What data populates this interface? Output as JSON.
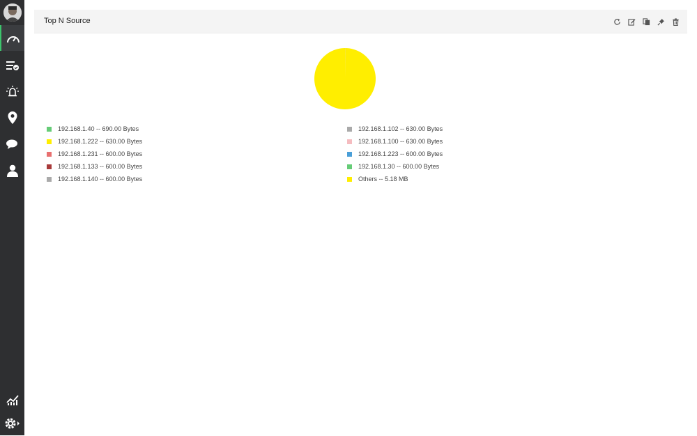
{
  "widget": {
    "title": "Top N Source"
  },
  "header_actions": [
    "refresh-icon",
    "edit-icon",
    "copy-icon",
    "pin-icon",
    "delete-icon"
  ],
  "sidebar": {
    "items": [
      "dashboard-icon",
      "inventory-icon",
      "alarm-icon",
      "map-icon",
      "chat-icon",
      "user-icon"
    ],
    "bottom": [
      "reports-icon",
      "settings-icon"
    ]
  },
  "chart_data": {
    "type": "pie",
    "title": "",
    "slices": [
      {
        "label": "192.168.1.40 -- 690.00 Bytes",
        "value": 690,
        "color": "#66cc77"
      },
      {
        "label": "192.168.1.222 -- 630.00 Bytes",
        "value": 630,
        "color": "#ffee00"
      },
      {
        "label": "192.168.1.231 -- 600.00 Bytes",
        "value": 600,
        "color": "#e87070"
      },
      {
        "label": "192.168.1.133 -- 600.00 Bytes",
        "value": 600,
        "color": "#a83a3a"
      },
      {
        "label": "192.168.1.140 -- 600.00 Bytes",
        "value": 600,
        "color": "#aaaaaa"
      },
      {
        "label": "192.168.1.102 -- 630.00 Bytes",
        "value": 630,
        "color": "#aaaaaa"
      },
      {
        "label": "192.168.1.100 -- 630.00 Bytes",
        "value": 630,
        "color": "#f5bcc0"
      },
      {
        "label": "192.168.1.223 -- 600.00 Bytes",
        "value": 600,
        "color": "#4a9fd8"
      },
      {
        "label": "192.168.1.30 -- 600.00 Bytes",
        "value": 600,
        "color": "#66cc77"
      },
      {
        "label": "Others -- 5.18 MB",
        "value": 5431623,
        "color": "#ffee00"
      }
    ],
    "legend_placement": "bottom"
  }
}
